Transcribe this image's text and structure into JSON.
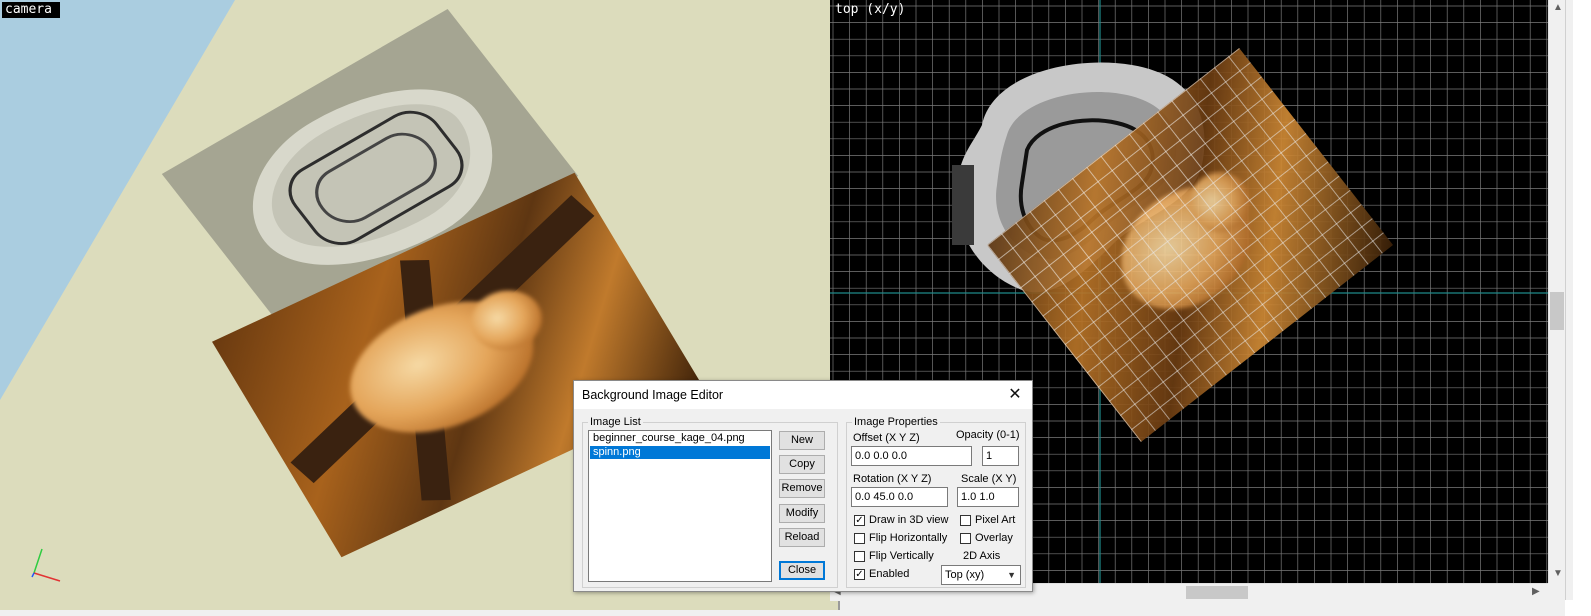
{
  "viewports": {
    "camera": {
      "label": "camera"
    },
    "top": {
      "label": "top (x/y)"
    }
  },
  "dialog": {
    "title": "Background Image Editor",
    "close_icon": "close-icon",
    "image_list": {
      "group_label": "Image List",
      "items": [
        "beginner_course_kage_04.png",
        "spinn.png"
      ],
      "selected": "spinn.png"
    },
    "buttons": {
      "new": "New",
      "copy": "Copy",
      "remove": "Remove",
      "modify": "Modify",
      "reload": "Reload",
      "close": "Close"
    },
    "properties": {
      "group_label": "Image Properties",
      "offset_label": "Offset (X Y Z)",
      "offset_value": "0.0 0.0 0.0",
      "opacity_label": "Opacity (0-1)",
      "opacity_value": "1",
      "rotation_label": "Rotation (X Y Z)",
      "rotation_value": "0.0 45.0 0.0",
      "scale_label": "Scale (X Y)",
      "scale_value": "1.0 1.0",
      "draw_3d_label": "Draw in 3D view",
      "draw_3d_checked": true,
      "pixel_art_label": "Pixel Art",
      "pixel_art_checked": false,
      "flip_h_label": "Flip Horizontally",
      "flip_h_checked": false,
      "overlay_label": "Overlay",
      "overlay_checked": false,
      "flip_v_label": "Flip Vertically",
      "flip_v_checked": false,
      "axis_label": "2D Axis",
      "enabled_label": "Enabled",
      "enabled_checked": true,
      "axis_value": "Top (xy)"
    }
  },
  "colors": {
    "sky": "#aacde0",
    "ground": "#dcdcbc",
    "selection": "#0078d7",
    "grid": "#7a7a7a"
  }
}
